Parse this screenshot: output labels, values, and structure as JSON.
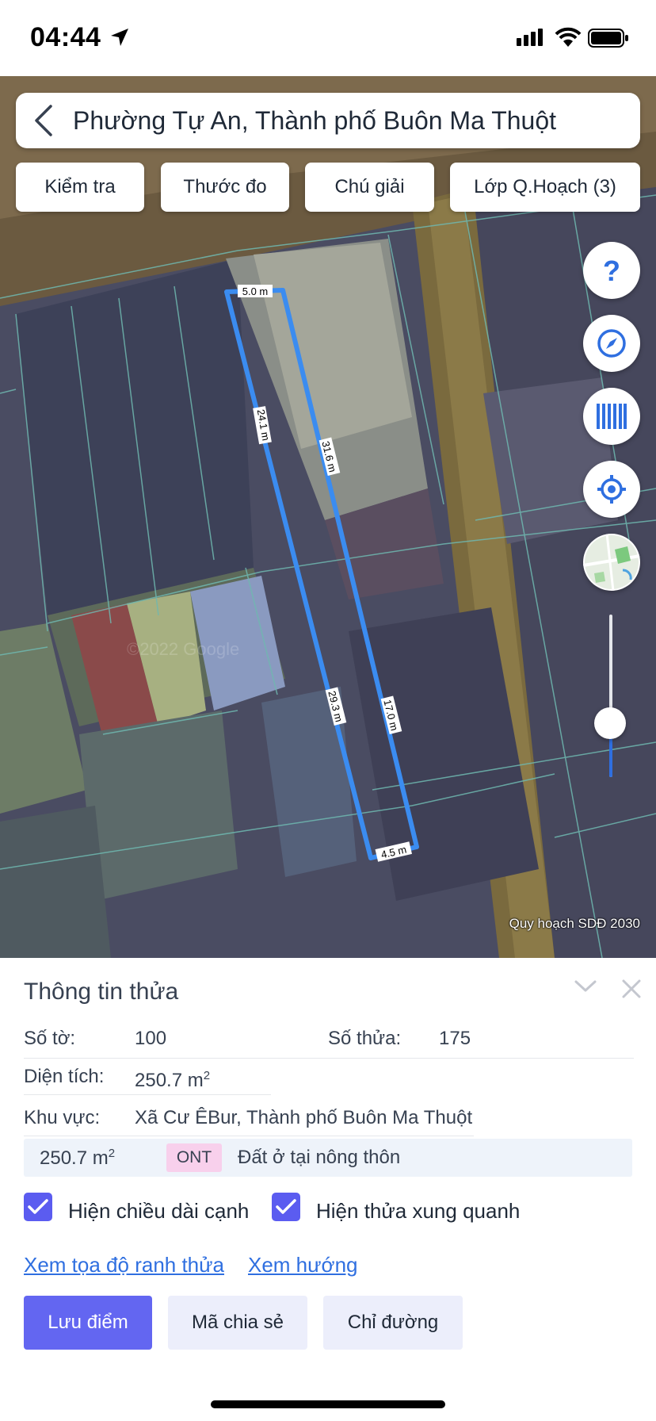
{
  "status_bar": {
    "time": "04:44"
  },
  "search": {
    "title": "Phường Tự An, Thành phố Buôn Ma Thuột"
  },
  "toolbar": {
    "check_label": "Kiểm tra",
    "ruler_label": "Thước đo",
    "legend_label": "Chú giải",
    "layers_label": "Lớp Q.Hoạch (3)"
  },
  "map": {
    "edge_labels": [
      "5.0 m",
      "24.1 m",
      "31.6 m",
      "29.3 m",
      "17.0 m",
      "4.5 m"
    ],
    "watermark": "©2022 Google",
    "credit": "Quy hoạch SDĐ 2030",
    "layer_slider_fraction": 0.37,
    "parcel_color": "#3b8cf0"
  },
  "panel": {
    "title": "Thông tin thửa",
    "sheet_label": "Số tờ:",
    "sheet_value": "100",
    "parcel_label": "Số thửa:",
    "parcel_value": "175",
    "area_label": "Diện tích:",
    "area_value": "250.7 m",
    "area_unit_sup": "2",
    "region_label": "Khu vực:",
    "region_value": "Xã Cư ÊBur, Thành phố Buôn Ma Thuột",
    "landuse": {
      "area": "250.7 m",
      "area_sup": "2",
      "code": "ONT",
      "description": "Đất ở tại nông thôn"
    },
    "show_edge_lengths_label": "Hiện chiều dài cạnh",
    "show_edge_lengths_checked": true,
    "show_neighbors_label": "Hiện thửa xung quanh",
    "show_neighbors_checked": true,
    "view_coords_link": "Xem tọa độ ranh thửa",
    "view_direction_link": "Xem hướng",
    "save_point_button": "Lưu điểm",
    "share_code_button": "Mã chia sẻ",
    "directions_button": "Chỉ đường"
  },
  "colors": {
    "accent": "#6366f1",
    "link": "#2f6fe0",
    "check": "#5b5cf0",
    "ont_badge": "#f8d0ec"
  }
}
